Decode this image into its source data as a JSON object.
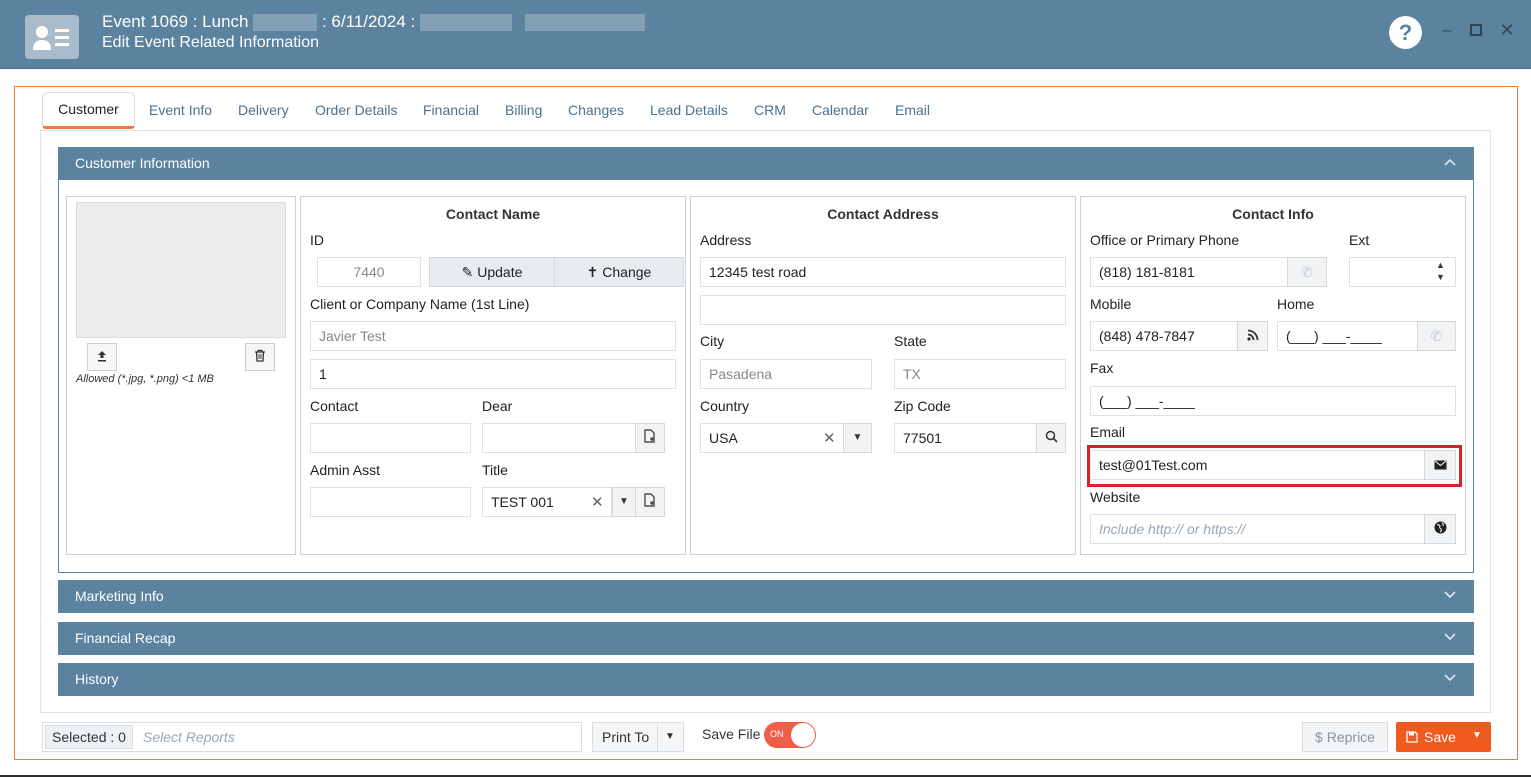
{
  "window": {
    "title_prefix": "Event 1069 : Lunch",
    "title_date": ": 6/11/2024 :",
    "subtitle": "Edit Event Related Information",
    "help_icon": "question-icon",
    "minimize_icon": "minimize-icon",
    "maximize_icon": "maximize-icon",
    "close_icon": "close-icon"
  },
  "tabs": [
    {
      "label": "Customer",
      "active": true
    },
    {
      "label": "Event Info"
    },
    {
      "label": "Delivery"
    },
    {
      "label": "Order Details"
    },
    {
      "label": "Financial"
    },
    {
      "label": "Billing"
    },
    {
      "label": "Changes"
    },
    {
      "label": "Lead Details"
    },
    {
      "label": "CRM"
    },
    {
      "label": "Calendar"
    },
    {
      "label": "Email"
    }
  ],
  "customer_section": {
    "title": "Customer Information",
    "photo": {
      "upload_icon": "upload-icon",
      "delete_icon": "trash-icon",
      "allowed_text": "Allowed (*.jpg, *.png) <1 MB"
    },
    "contact_name": {
      "title": "Contact Name",
      "id_label": "ID",
      "id_value": "7440",
      "update_label": "Update",
      "change_label": "Change",
      "company_label": "Client or Company Name (1st Line)",
      "company_value": "Javier Test",
      "company_line2": "1",
      "contact_label": "Contact",
      "contact_value": "",
      "dear_label": "Dear",
      "dear_value": "",
      "admin_label": "Admin Asst",
      "admin_value": "",
      "title_label": "Title",
      "title_value": "TEST 001"
    },
    "contact_address": {
      "title": "Contact Address",
      "address_label": "Address",
      "address_line1": "12345 test road",
      "address_line2": "",
      "city_label": "City",
      "city_value": "Pasadena",
      "state_label": "State",
      "state_value": "TX",
      "country_label": "Country",
      "country_value": "USA",
      "zip_label": "Zip Code",
      "zip_value": "77501"
    },
    "contact_info": {
      "title": "Contact Info",
      "office_label": "Office or Primary Phone",
      "office_value": "(818) 181-8181",
      "ext_label": "Ext",
      "ext_value": "",
      "mobile_label": "Mobile",
      "mobile_value": "(848) 478-7847",
      "home_label": "Home",
      "home_value": "(___) ___-____",
      "fax_label": "Fax",
      "fax_value": "(___) ___-____",
      "email_label": "Email",
      "email_value": "test@01Test.com",
      "website_label": "Website",
      "website_placeholder": "Include http:// or https://"
    }
  },
  "collapsed_sections": [
    {
      "label": "Marketing Info"
    },
    {
      "label": "Financial Recap"
    },
    {
      "label": "History"
    }
  ],
  "footer": {
    "selected_label": "Selected : 0",
    "reports_placeholder": "Select Reports",
    "print_label": "Print To",
    "save_file_label": "Save File",
    "toggle_state": "ON",
    "reprice_label": "Reprice",
    "save_label": "Save"
  },
  "colors": {
    "header_blue": "#5b829f",
    "accent_orange": "#f07a3a",
    "save_orange": "#f05a1f",
    "highlight_red": "#d9232a"
  }
}
